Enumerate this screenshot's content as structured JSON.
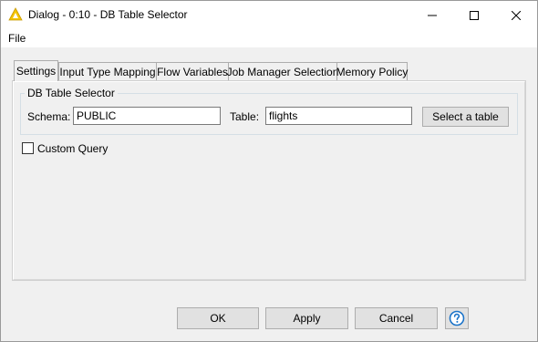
{
  "window": {
    "title": "Dialog - 0:10 - DB Table Selector",
    "minimize_label": "Minimize",
    "maximize_label": "Maximize",
    "close_label": "Close"
  },
  "menu": {
    "file_label": "File"
  },
  "tabs": [
    {
      "label": "Settings",
      "active": true
    },
    {
      "label": "Input Type Mapping",
      "active": false
    },
    {
      "label": "Flow Variables",
      "active": false
    },
    {
      "label": "Job Manager Selection",
      "active": false
    },
    {
      "label": "Memory Policy",
      "active": false
    }
  ],
  "settings": {
    "group_title": "DB Table Selector",
    "schema_label": "Schema:",
    "schema_value": "PUBLIC",
    "table_label": "Table:",
    "table_value": "flights",
    "select_table_label": "Select a table",
    "custom_query_label": "Custom Query",
    "custom_query_checked": false
  },
  "footer": {
    "ok_label": "OK",
    "apply_label": "Apply",
    "cancel_label": "Cancel",
    "help_icon": "question-circle-icon"
  },
  "colors": {
    "accent": "#f5c400",
    "help_blue": "#1a73c9"
  }
}
